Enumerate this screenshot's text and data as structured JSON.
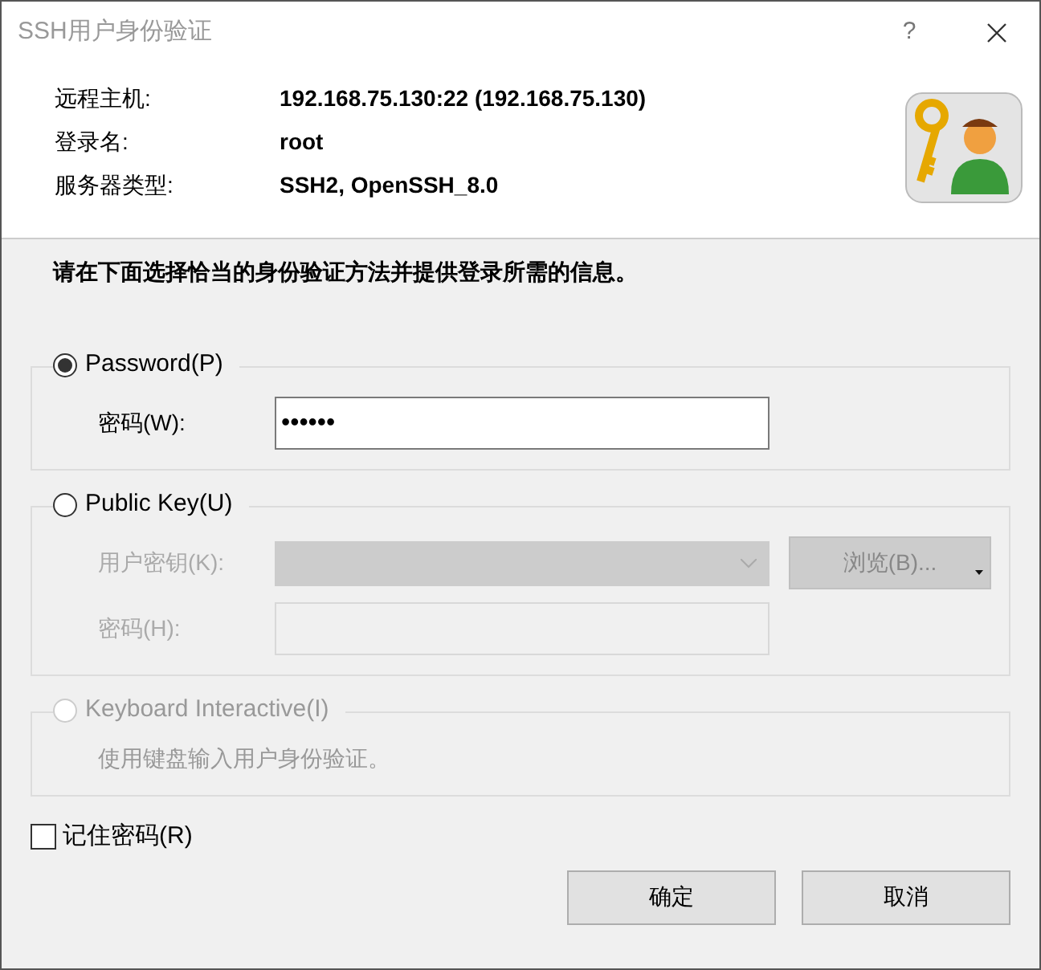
{
  "window": {
    "title": "SSH用户身份验证",
    "help": "?"
  },
  "info": [
    {
      "label": "远程主机:",
      "value": "192.168.75.130:22 (192.168.75.130)"
    },
    {
      "label": "登录名:",
      "value": "root"
    },
    {
      "label": "服务器类型:",
      "value": "SSH2, OpenSSH_8.0"
    }
  ],
  "instruction": "请在下面选择恰当的身份验证方法并提供登录所需的信息。",
  "methods": [
    {
      "label": "Password(P)",
      "selected": true,
      "disabled": false,
      "fields": [
        {
          "kind": "text",
          "label": "密码(W):",
          "value": "••••••",
          "disabled": false
        }
      ]
    },
    {
      "label": "Public Key(U)",
      "selected": false,
      "disabled": false,
      "fields": [
        {
          "kind": "dropdown",
          "label": "用户密钥(K):",
          "disabled": true
        },
        {
          "kind": "text",
          "label": "密码(H):",
          "disabled": true
        }
      ],
      "browse_button": {
        "label": "浏览(B)...",
        "disabled": true
      }
    },
    {
      "label": "Keyboard Interactive(I)",
      "selected": false,
      "disabled": true,
      "description": "使用键盘输入用户身份验证。"
    }
  ],
  "remember": {
    "label": "记住密码(R)",
    "checked": false
  },
  "buttons": [
    "确定",
    "取消"
  ]
}
